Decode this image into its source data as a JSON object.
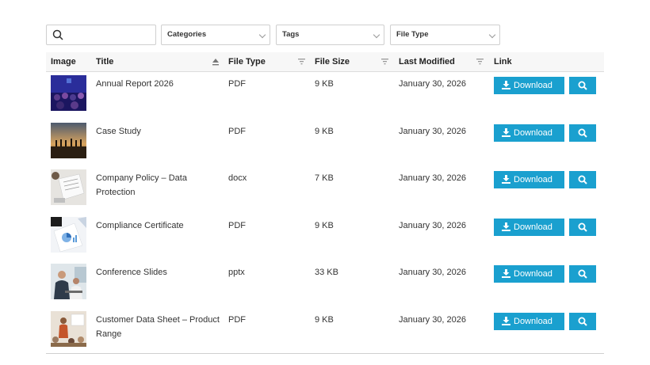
{
  "filters": {
    "search_placeholder": "",
    "categories_label": "Categories",
    "tags_label": "Tags",
    "filetype_label": "File Type"
  },
  "table": {
    "headers": {
      "image": "Image",
      "title": "Title",
      "file_type": "File Type",
      "file_size": "File Size",
      "last_modified": "Last Modified",
      "link": "Link"
    },
    "download_label": "Download",
    "rows": [
      {
        "title": "Annual Report 2026",
        "file_type": "PDF",
        "file_size": "9 KB",
        "last_modified": "January 30, 2026"
      },
      {
        "title": "Case Study",
        "file_type": "PDF",
        "file_size": "9 KB",
        "last_modified": "January 30, 2026"
      },
      {
        "title": "Company Policy – Data Protection",
        "file_type": "docx",
        "file_size": "7 KB",
        "last_modified": "January 30, 2026"
      },
      {
        "title": "Compliance Certificate",
        "file_type": "PDF",
        "file_size": "9 KB",
        "last_modified": "January 30, 2026"
      },
      {
        "title": "Conference Slides",
        "file_type": "pptx",
        "file_size": "33 KB",
        "last_modified": "January 30, 2026"
      },
      {
        "title": "Customer Data Sheet – Product Range",
        "file_type": "PDF",
        "file_size": "9 KB",
        "last_modified": "January 30, 2026"
      }
    ]
  },
  "colors": {
    "accent": "#1aa0cf",
    "header_bg": "#f7f7f7",
    "border": "#cfcfcf"
  }
}
